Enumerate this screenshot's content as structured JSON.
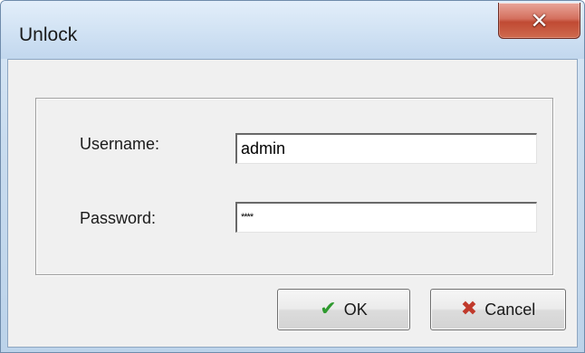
{
  "window": {
    "title": "Unlock",
    "close_icon": "close-icon"
  },
  "form": {
    "username_label": "Username:",
    "username_value": "admin",
    "password_label": "Password:",
    "password_value": "****"
  },
  "buttons": {
    "ok_label": "OK",
    "ok_icon": "check-icon",
    "cancel_label": "Cancel",
    "cancel_icon": "x-icon"
  },
  "colors": {
    "title_bar": "#c9dcef",
    "close_button": "#c04a33",
    "dialog_background": "#f0f0f0",
    "ok_check": "#2f9a2f",
    "cancel_x": "#c0392b"
  }
}
